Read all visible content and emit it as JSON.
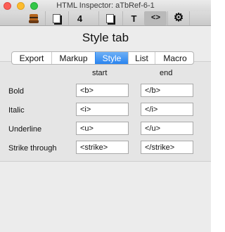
{
  "window": {
    "title": "HTML Inspector: aTbRef-6-1"
  },
  "toolbar": {
    "buttons": [
      {
        "icon": "book-icon"
      },
      {
        "icon": "page-icon"
      },
      {
        "icon": "page-count-icon",
        "label": "4"
      },
      {
        "icon": "page-icon"
      },
      {
        "icon": "text-icon",
        "label": "T"
      },
      {
        "icon": "code-icon",
        "label": "<>"
      },
      {
        "icon": "gear-icon",
        "label": "⚙"
      }
    ]
  },
  "panel": {
    "title": "Style tab"
  },
  "tabs": [
    {
      "label": "Export"
    },
    {
      "label": "Markup"
    },
    {
      "label": "Style",
      "selected": true
    },
    {
      "label": "List"
    },
    {
      "label": "Macro"
    }
  ],
  "columns": {
    "start": "start",
    "end": "end"
  },
  "rows": [
    {
      "label": "Bold",
      "start": "<b>",
      "end": "</b>"
    },
    {
      "label": "Italic",
      "start": "<i>",
      "end": "</i>"
    },
    {
      "label": "Underline",
      "start": "<u>",
      "end": "</u>"
    },
    {
      "label": "Strike through",
      "start": "<strike>",
      "end": "</strike>"
    }
  ],
  "colors": {
    "accent": "#2a84ef"
  }
}
